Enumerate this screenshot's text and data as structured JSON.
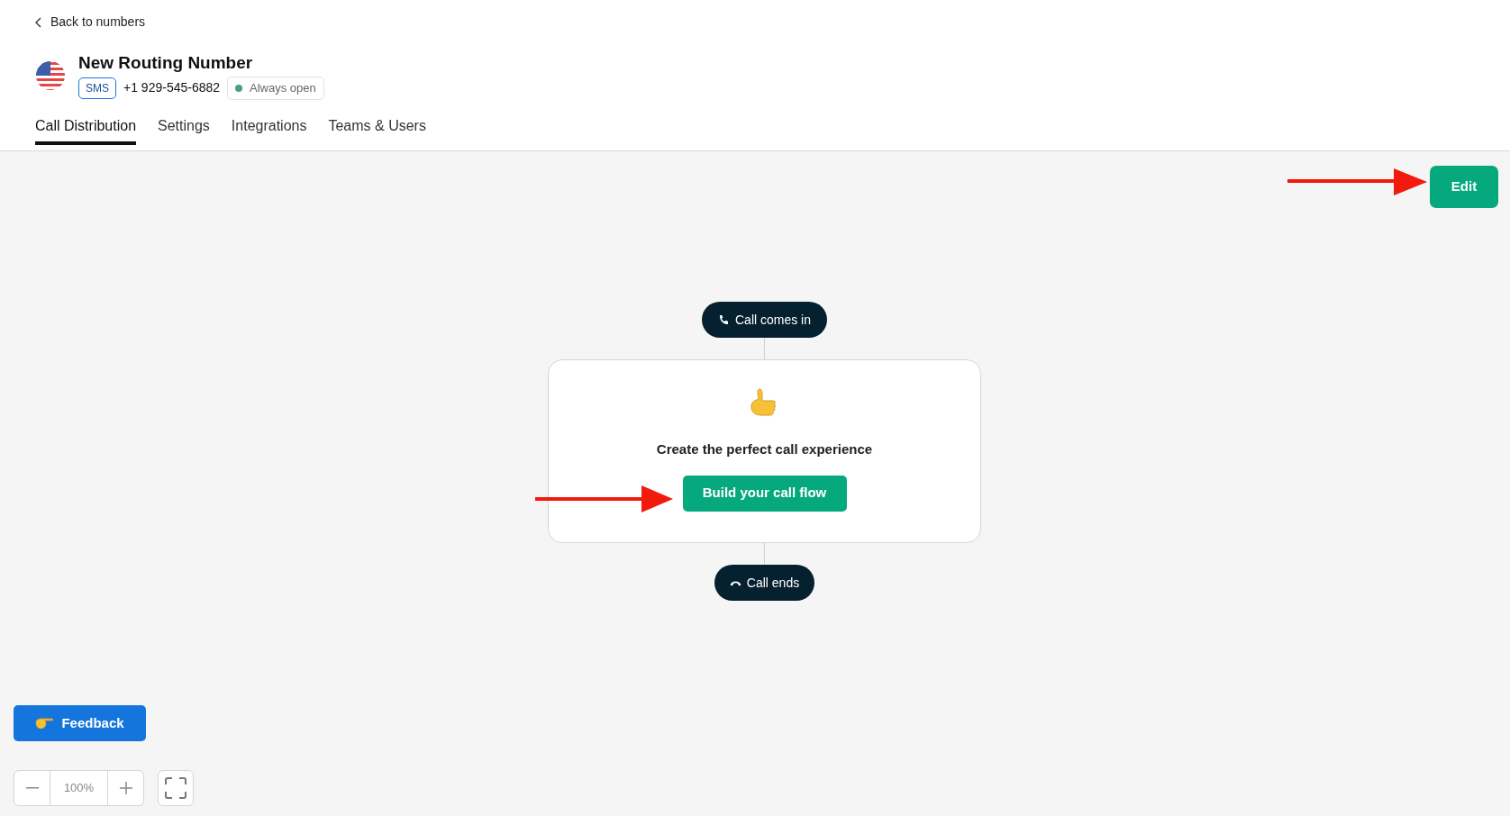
{
  "back_link": "Back to numbers",
  "header": {
    "title": "New Routing Number",
    "channel_badge": "SMS",
    "phone": "+1 929-545-6882",
    "status": "Always open"
  },
  "tabs": [
    {
      "label": "Call Distribution",
      "selected": true
    },
    {
      "label": "Settings",
      "selected": false
    },
    {
      "label": "Integrations",
      "selected": false
    },
    {
      "label": "Teams & Users",
      "selected": false
    }
  ],
  "edit_button": "Edit",
  "flow": {
    "start": "Call comes in",
    "card": {
      "message": "Create the perfect call experience",
      "button": "Build your call flow"
    },
    "end": "Call ends"
  },
  "feedback_button": "Feedback",
  "zoom": {
    "level": "100%"
  }
}
